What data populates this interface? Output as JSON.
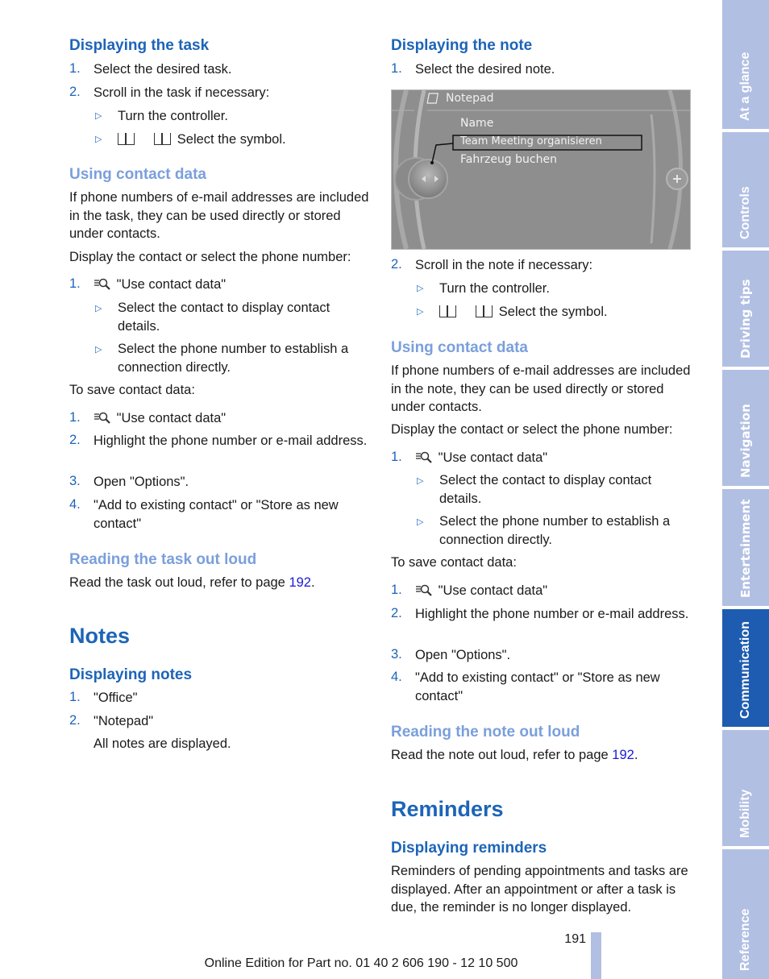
{
  "left": {
    "displaying_task": {
      "heading": "Displaying the task",
      "steps": [
        "Select the desired task.",
        "Scroll in the task if necessary:"
      ],
      "sub": [
        "Turn the controller.",
        "Select the symbol."
      ]
    },
    "using_contact": {
      "heading": "Using contact data",
      "para1": "If phone numbers of e-mail addresses are included in the task, they can be used directly or stored under contacts.",
      "para2": "Display the contact or select the phone number:",
      "step1": "\"Use contact data\"",
      "sub": [
        "Select the contact to display contact details.",
        "Select the phone number to establish a connection directly."
      ],
      "save_label": "To save contact data:",
      "save_steps": [
        "\"Use contact data\"",
        "Highlight the phone number or e-mail address.",
        "Open \"Options\".",
        "\"Add to existing contact\" or \"Store as new contact\""
      ]
    },
    "reading": {
      "heading": "Reading the task out loud",
      "text": "Read the task out loud, refer to page ",
      "page": "192",
      "end": "."
    },
    "notes_heading": "Notes",
    "displaying_notes": {
      "heading": "Displaying notes",
      "steps": [
        "\"Office\"",
        "\"Notepad\""
      ],
      "after": "All notes are displayed."
    }
  },
  "right": {
    "displaying_note": {
      "heading": "Displaying the note",
      "step1": "Select the desired note.",
      "step2": "Scroll in the note if necessary:",
      "sub": [
        "Turn the controller.",
        "Select the symbol."
      ]
    },
    "screen": {
      "title": "Notepad",
      "items": [
        "Name",
        "Team Meeting organisieren",
        "Fahrzeug buchen"
      ],
      "selected_index": 1
    },
    "using_contact": {
      "heading": "Using contact data",
      "para1": "If phone numbers of e-mail addresses are included in the note, they can be used directly or stored under contacts.",
      "para2": "Display the contact or select the phone number:",
      "step1": "\"Use contact data\"",
      "sub": [
        "Select the contact to display contact details.",
        "Select the phone number to establish a connection directly."
      ],
      "save_label": "To save contact data:",
      "save_steps": [
        "\"Use contact data\"",
        "Highlight the phone number or e-mail address.",
        "Open \"Options\".",
        "\"Add to existing contact\" or \"Store as new contact\""
      ]
    },
    "reading": {
      "heading": "Reading the note out loud",
      "text": "Read the note out loud, refer to page ",
      "page": "192",
      "end": "."
    },
    "reminders_heading": "Reminders",
    "displaying_reminders": {
      "heading": "Displaying reminders",
      "text": "Reminders of pending appointments and tasks are displayed. After an appointment or after a task is due, the reminder is no longer displayed."
    }
  },
  "tabs": [
    "At a glance",
    "Controls",
    "Driving tips",
    "Navigation",
    "Entertainment",
    "Communication",
    "Mobility",
    "Reference"
  ],
  "active_tab": "Communication",
  "page_number": "191",
  "footer": "Online Edition for Part no. 01 40 2 606 190 - 12 10 500",
  "colors": {
    "heading": "#1d64b8",
    "subheading_light": "#7a9fdc",
    "tab": "#b1bfe3",
    "tab_active": "#1d5cb0",
    "link": "#1a1ad6"
  }
}
